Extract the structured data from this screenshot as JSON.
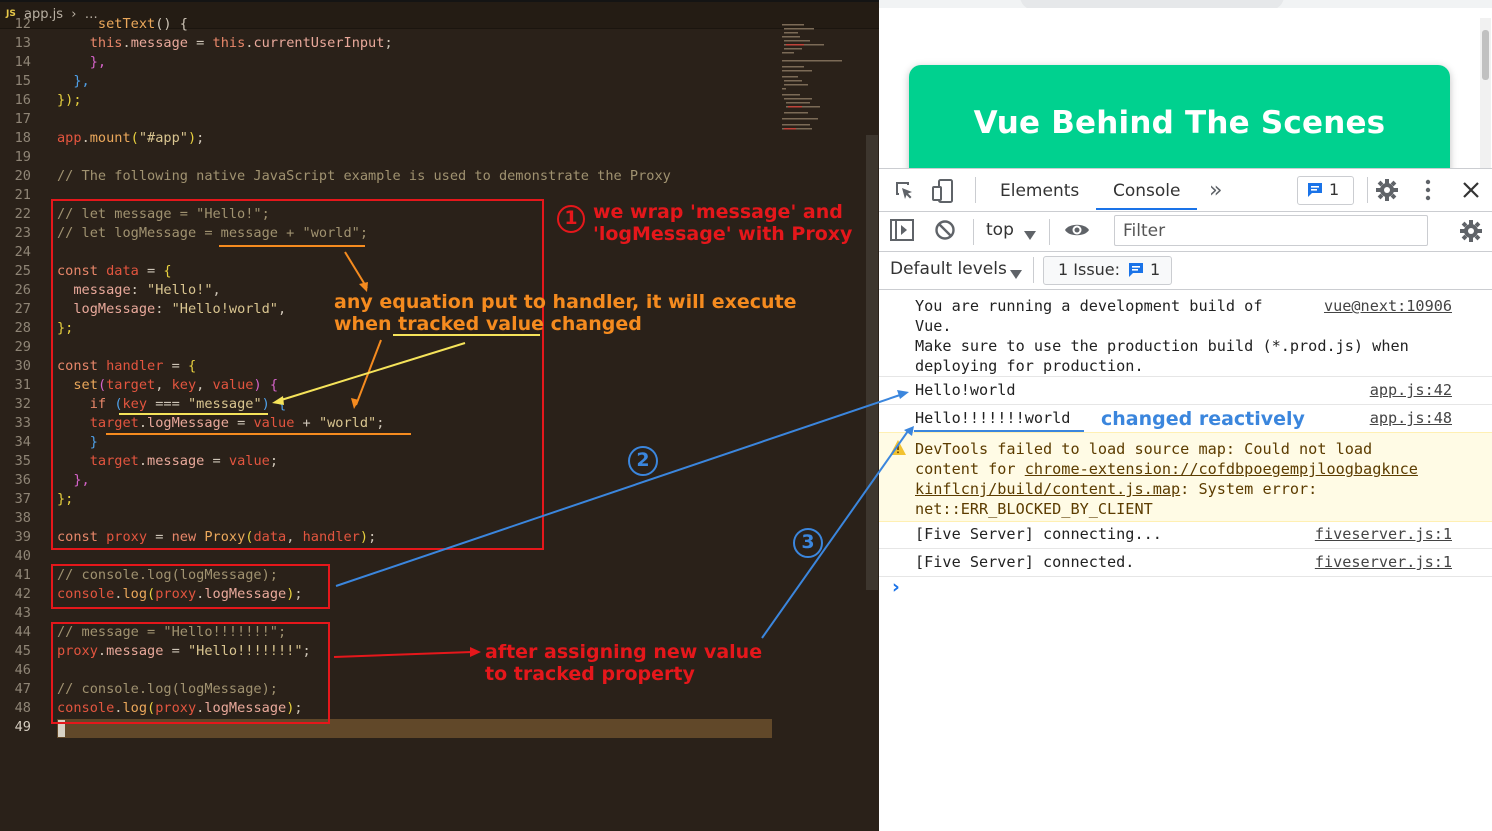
{
  "editor": {
    "tab_icon": "JS",
    "breadcrumb": "app.js  ›  …",
    "lines": [
      {
        "n": "12",
        "segs": [
          [
            "     ",
            "pun"
          ],
          [
            "setText",
            "fn"
          ],
          [
            "() {",
            "pun"
          ]
        ]
      },
      {
        "n": "13",
        "segs": [
          [
            "    ",
            "pun"
          ],
          [
            "this",
            "kw"
          ],
          [
            ".",
            "pun"
          ],
          [
            "message",
            "prop"
          ],
          [
            " = ",
            "pun"
          ],
          [
            "this",
            "kw"
          ],
          [
            ".",
            "pun"
          ],
          [
            "currentUserInput",
            "prop"
          ],
          [
            ";",
            "pun"
          ]
        ]
      },
      {
        "n": "14",
        "segs": [
          [
            "    ",
            "pun"
          ],
          [
            "},",
            "brace2"
          ]
        ]
      },
      {
        "n": "15",
        "segs": [
          [
            "  ",
            "pun"
          ],
          [
            "},",
            "brace3"
          ]
        ]
      },
      {
        "n": "16",
        "segs": [
          [
            "});",
            "brace"
          ]
        ]
      },
      {
        "n": "17",
        "segs": []
      },
      {
        "n": "18",
        "segs": [
          [
            "app",
            "var"
          ],
          [
            ".",
            "pun"
          ],
          [
            "mount",
            "fn"
          ],
          [
            "(",
            "brace"
          ],
          [
            "\"#app\"",
            "str"
          ],
          [
            ")",
            "brace"
          ],
          [
            ";",
            "pun"
          ]
        ]
      },
      {
        "n": "19",
        "segs": []
      },
      {
        "n": "20",
        "segs": [
          [
            "// The following native JavaScript example is used to demonstrate the Proxy",
            "com"
          ]
        ]
      },
      {
        "n": "21",
        "segs": []
      },
      {
        "n": "22",
        "segs": [
          [
            "// let message = \"Hello!\";",
            "com"
          ]
        ]
      },
      {
        "n": "23",
        "segs": [
          [
            "// let logMessage = message + \"world\";",
            "com"
          ]
        ]
      },
      {
        "n": "24",
        "segs": []
      },
      {
        "n": "25",
        "segs": [
          [
            "const ",
            "kw"
          ],
          [
            "data",
            "var"
          ],
          [
            " = ",
            "pun"
          ],
          [
            "{",
            "brace"
          ]
        ]
      },
      {
        "n": "26",
        "segs": [
          [
            "  ",
            "pun"
          ],
          [
            "message",
            "prop"
          ],
          [
            ": ",
            "pun"
          ],
          [
            "\"Hello!\"",
            "str"
          ],
          [
            ",",
            "pun"
          ]
        ]
      },
      {
        "n": "27",
        "segs": [
          [
            "  ",
            "pun"
          ],
          [
            "logMessage",
            "prop"
          ],
          [
            ": ",
            "pun"
          ],
          [
            "\"Hello!world\"",
            "str"
          ],
          [
            ",",
            "pun"
          ]
        ]
      },
      {
        "n": "28",
        "segs": [
          [
            "};",
            "brace"
          ]
        ]
      },
      {
        "n": "29",
        "segs": []
      },
      {
        "n": "30",
        "segs": [
          [
            "const ",
            "kw"
          ],
          [
            "handler",
            "var"
          ],
          [
            " = ",
            "pun"
          ],
          [
            "{",
            "brace"
          ]
        ]
      },
      {
        "n": "31",
        "segs": [
          [
            "  ",
            "pun"
          ],
          [
            "set",
            "fn"
          ],
          [
            "(",
            "brace2"
          ],
          [
            "target",
            "var"
          ],
          [
            ", ",
            "pun"
          ],
          [
            "key",
            "var"
          ],
          [
            ", ",
            "pun"
          ],
          [
            "value",
            "var"
          ],
          [
            ") ",
            "brace2"
          ],
          [
            "{",
            "brace2"
          ]
        ]
      },
      {
        "n": "32",
        "segs": [
          [
            "    ",
            "pun"
          ],
          [
            "if ",
            "kw"
          ],
          [
            "(",
            "brace3"
          ],
          [
            "key",
            "var"
          ],
          [
            " === ",
            "pun"
          ],
          [
            "\"message\"",
            "str"
          ],
          [
            ") ",
            "brace3"
          ],
          [
            "{",
            "brace3"
          ]
        ]
      },
      {
        "n": "33",
        "segs": [
          [
            "    ",
            "pun"
          ],
          [
            "target",
            "var"
          ],
          [
            ".",
            "pun"
          ],
          [
            "logMessage",
            "prop"
          ],
          [
            " = ",
            "pun"
          ],
          [
            "value",
            "var"
          ],
          [
            " + ",
            "pun"
          ],
          [
            "\"world\"",
            "str"
          ],
          [
            ";",
            "pun"
          ]
        ]
      },
      {
        "n": "34",
        "segs": [
          [
            "    ",
            "pun"
          ],
          [
            "}",
            "brace3"
          ]
        ]
      },
      {
        "n": "35",
        "segs": [
          [
            "    ",
            "pun"
          ],
          [
            "target",
            "var"
          ],
          [
            ".",
            "pun"
          ],
          [
            "message",
            "prop"
          ],
          [
            " = ",
            "pun"
          ],
          [
            "value",
            "var"
          ],
          [
            ";",
            "pun"
          ]
        ]
      },
      {
        "n": "36",
        "segs": [
          [
            "  ",
            "pun"
          ],
          [
            "},",
            "brace2"
          ]
        ]
      },
      {
        "n": "37",
        "segs": [
          [
            "};",
            "brace"
          ]
        ]
      },
      {
        "n": "38",
        "segs": []
      },
      {
        "n": "39",
        "segs": [
          [
            "const ",
            "kw"
          ],
          [
            "proxy",
            "var"
          ],
          [
            " = ",
            "pun"
          ],
          [
            "new ",
            "kw"
          ],
          [
            "Proxy",
            "fn"
          ],
          [
            "(",
            "brace"
          ],
          [
            "data",
            "var"
          ],
          [
            ", ",
            "pun"
          ],
          [
            "handler",
            "var"
          ],
          [
            ")",
            "brace"
          ],
          [
            ";",
            "pun"
          ]
        ]
      },
      {
        "n": "40",
        "segs": []
      },
      {
        "n": "41",
        "segs": [
          [
            "// console.log(logMessage);",
            "com"
          ]
        ]
      },
      {
        "n": "42",
        "segs": [
          [
            "console",
            "var"
          ],
          [
            ".",
            "pun"
          ],
          [
            "log",
            "fn"
          ],
          [
            "(",
            "brace"
          ],
          [
            "proxy",
            "var"
          ],
          [
            ".",
            "pun"
          ],
          [
            "logMessage",
            "prop"
          ],
          [
            ")",
            "brace"
          ],
          [
            ";",
            "pun"
          ]
        ]
      },
      {
        "n": "43",
        "segs": []
      },
      {
        "n": "44",
        "segs": [
          [
            "// message = \"Hello!!!!!!!\";",
            "com"
          ]
        ]
      },
      {
        "n": "45",
        "segs": [
          [
            "proxy",
            "var"
          ],
          [
            ".",
            "pun"
          ],
          [
            "message",
            "prop"
          ],
          [
            " = ",
            "pun"
          ],
          [
            "\"Hello!!!!!!!\"",
            "str"
          ],
          [
            ";",
            "pun"
          ]
        ]
      },
      {
        "n": "46",
        "segs": []
      },
      {
        "n": "47",
        "segs": [
          [
            "// console.log(logMessage);",
            "com"
          ]
        ]
      },
      {
        "n": "48",
        "segs": [
          [
            "console",
            "var"
          ],
          [
            ".",
            "pun"
          ],
          [
            "log",
            "fn"
          ],
          [
            "(",
            "brace"
          ],
          [
            "proxy",
            "var"
          ],
          [
            ".",
            "pun"
          ],
          [
            "logMessage",
            "prop"
          ],
          [
            ")",
            "brace"
          ],
          [
            ";",
            "pun"
          ]
        ]
      },
      {
        "n": "49",
        "segs": []
      }
    ]
  },
  "browser": {
    "page_title": "Vue Behind The Scenes"
  },
  "devtools": {
    "tabs": {
      "elements": "Elements",
      "console": "Console",
      "more": "»"
    },
    "issues_count": "1",
    "context_select": "top",
    "filter_placeholder": "Filter",
    "levels_select": "Default levels",
    "issue_pill_label": "1 Issue:",
    "issue_pill_count": "1",
    "console_rows": [
      {
        "kind": "info",
        "msg": "You are running a development build of\nVue.\nMake sure to use the production build (*.prod.js) when\ndeploying for production.",
        "src": "vue@next:10906"
      },
      {
        "kind": "log",
        "msg": "Hello!world",
        "src": "app.js:42"
      },
      {
        "kind": "log",
        "msg": "Hello!!!!!!!world",
        "src": "app.js:48"
      },
      {
        "kind": "warn",
        "msg_pre": "DevTools failed to load source map: Could not load\ncontent for ",
        "msg_link": "chrome-extension://cofdbpoegempjloogbagknce\nkinflcnj/build/content.js.map",
        "msg_post": ": System error:\nnet::ERR_BLOCKED_BY_CLIENT"
      },
      {
        "kind": "log",
        "msg": "[Five Server] connecting...",
        "src": "fiveserver.js:1"
      },
      {
        "kind": "log",
        "msg": "[Five Server] connected.",
        "src": "fiveserver.js:1"
      }
    ],
    "prompt": "›"
  },
  "annotations": {
    "note1_num": "1",
    "note1": "we wrap 'message' and\n'logMessage' with Proxy",
    "note_handler": "any equation put to handler, it will execute\nwhen tracked value changed",
    "note2_num": "2",
    "note3_num": "3",
    "note_after": "after assigning new value\nto tracked property",
    "note_changed": "changed reactively"
  },
  "colors": {
    "editor_bg": "#2a2119",
    "header_green": "#00d18f",
    "annotation_red": "#e5171b",
    "annotation_orange": "#f58b1f",
    "annotation_blue": "#3b86dd",
    "annotation_yellow": "#f5e35a"
  }
}
